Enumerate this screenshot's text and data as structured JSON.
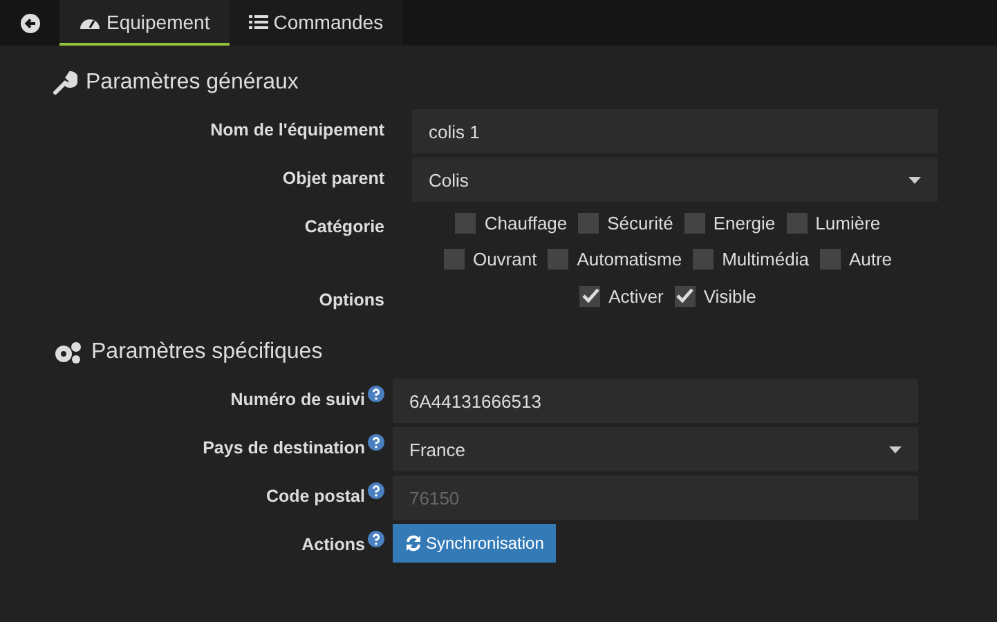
{
  "tabs": [
    {
      "label": "Equipement",
      "selected": true
    },
    {
      "label": "Commandes",
      "selected": false
    }
  ],
  "sections": [
    {
      "title": "Paramètres généraux",
      "rows": [
        {
          "kind": "text",
          "label": "Nom de l'équipement",
          "help": false,
          "value": "colis 1"
        },
        {
          "kind": "select",
          "label": "Objet parent",
          "help": false,
          "value": "Colis"
        },
        {
          "kind": "checks",
          "label": "Catégorie",
          "help": false,
          "items": [
            {
              "label": "Chauffage",
              "checked": false
            },
            {
              "label": "Sécurité",
              "checked": false
            },
            {
              "label": "Energie",
              "checked": false
            },
            {
              "label": "Lumière",
              "checked": false
            },
            {
              "label": "Ouvrant",
              "checked": false
            },
            {
              "label": "Automatisme",
              "checked": false
            },
            {
              "label": "Multimédia",
              "checked": false
            },
            {
              "label": "Autre",
              "checked": false
            }
          ]
        },
        {
          "kind": "checks",
          "label": "Options",
          "help": false,
          "items": [
            {
              "label": "Activer",
              "checked": true
            },
            {
              "label": "Visible",
              "checked": true
            }
          ]
        }
      ]
    },
    {
      "title": "Paramètres spécifiques",
      "rows": [
        {
          "kind": "text",
          "label": "Numéro de suivi",
          "help": true,
          "value": "6A44131666513"
        },
        {
          "kind": "select",
          "label": "Pays de destination",
          "help": true,
          "value": "France"
        },
        {
          "kind": "text",
          "label": "Code postal",
          "help": true,
          "placeholder": "76150"
        },
        {
          "kind": "button",
          "label": "Actions",
          "help": true,
          "value": "Synchronisation"
        }
      ]
    }
  ]
}
